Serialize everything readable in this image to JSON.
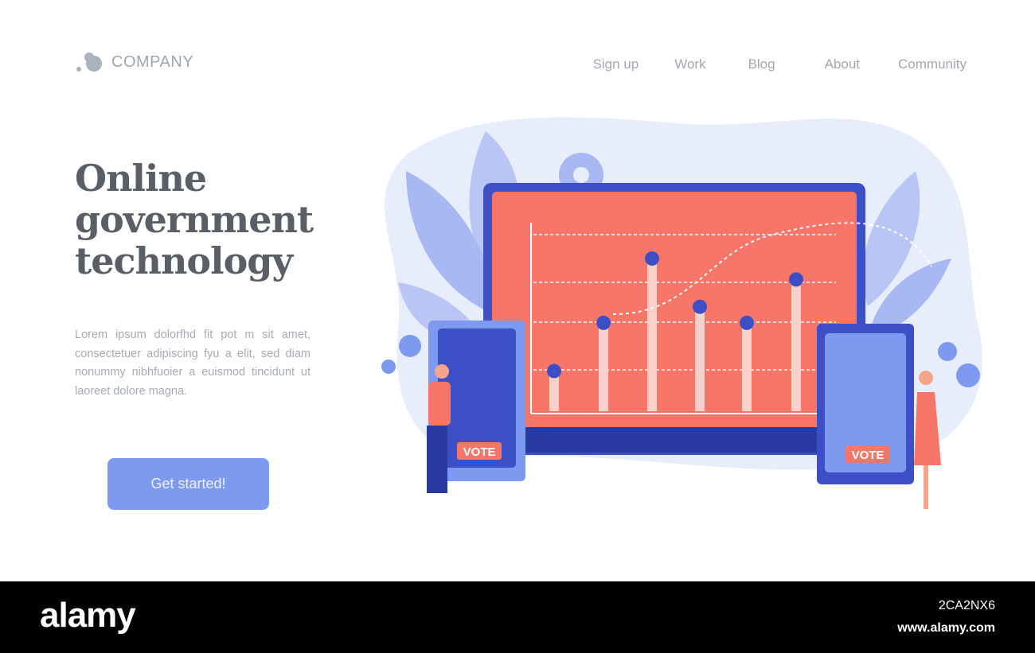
{
  "header": {
    "logo_text": "COMPANY",
    "nav": [
      "Sign up",
      "Work",
      "Blog",
      "About",
      "Community"
    ]
  },
  "hero": {
    "title_lines": [
      "Online",
      "government",
      "technology"
    ],
    "body": "Lorem ipsum dolorfhd fit pot m sit amet, consectetuer adipiscing fyu  a elit, sed diam nonummy nibhfuoier a euismod tincidunt ut laoreet dolore magna.",
    "cta_label": "Get started!"
  },
  "illustration": {
    "vote_label": "VOTE",
    "bar_levels": [
      0.25,
      0.55,
      0.95,
      0.65,
      0.55,
      0.82
    ],
    "colors": {
      "screen": "#f6776a",
      "blue": "#3d4fc7",
      "accent": "#7e99f0",
      "blob": "#e8edfb"
    }
  },
  "watermark": {
    "brand": "alamy",
    "image_id": "2CA2NX6",
    "url": "www.alamy.com"
  }
}
